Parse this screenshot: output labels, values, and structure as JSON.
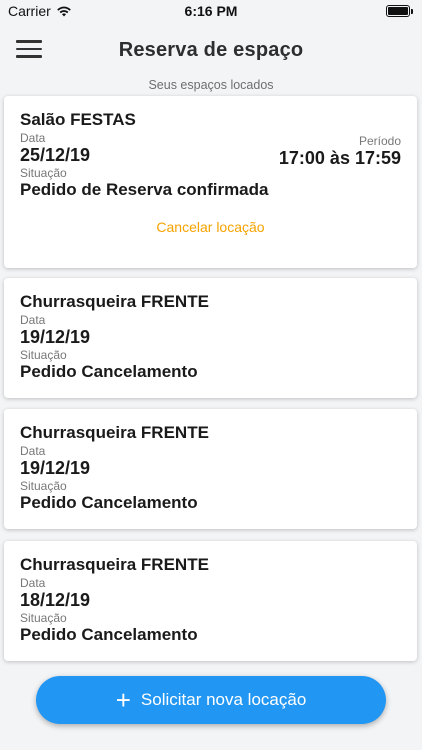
{
  "status_bar": {
    "carrier": "Carrier",
    "time": "6:16 PM"
  },
  "header": {
    "title": "Reserva de espaço",
    "subtitle": "Seus espaços locados"
  },
  "reservations": [
    {
      "space": "Salão FESTAS",
      "date_label": "Data",
      "date": "25/12/19",
      "status_label": "Situação",
      "status": "Pedido de Reserva confirmada",
      "period_label": "Período",
      "period": "17:00 às 17:59",
      "cancel_label": "Cancelar locação"
    },
    {
      "space": "Churrasqueira FRENTE",
      "date_label": "Data",
      "date": "19/12/19",
      "status_label": "Situação",
      "status": "Pedido Cancelamento"
    },
    {
      "space": "Churrasqueira FRENTE",
      "date_label": "Data",
      "date": "19/12/19",
      "status_label": "Situação",
      "status": "Pedido Cancelamento"
    },
    {
      "space": "Churrasqueira FRENTE",
      "date_label": "Data",
      "date": "18/12/19",
      "status_label": "Situação",
      "status": "Pedido Cancelamento"
    }
  ],
  "action_button": {
    "label": "Solicitar nova locação",
    "icon": "plus-icon"
  },
  "colors": {
    "accent": "#2196f3",
    "cancel": "#f5a300",
    "background": "#f3f4f6"
  }
}
